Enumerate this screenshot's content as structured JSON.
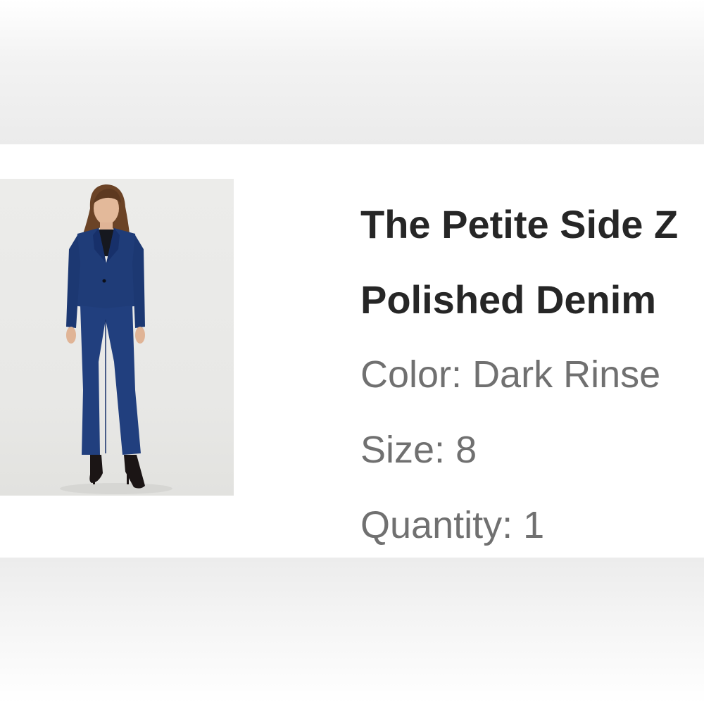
{
  "product": {
    "title_line1": "The Petite Side Z",
    "title_line2": "Polished Denim",
    "color_label": "Color:",
    "color_value": "Dark Rinse",
    "size_label": "Size:",
    "size_value": "8",
    "quantity_label": "Quantity:",
    "quantity_value": "1",
    "image_alt": "Model wearing navy blazer and flare trousers with black heels"
  },
  "colors": {
    "title_text": "#262626",
    "attribute_text": "#707070",
    "suit_navy": "#1f3c78",
    "background": "#ffffff"
  }
}
